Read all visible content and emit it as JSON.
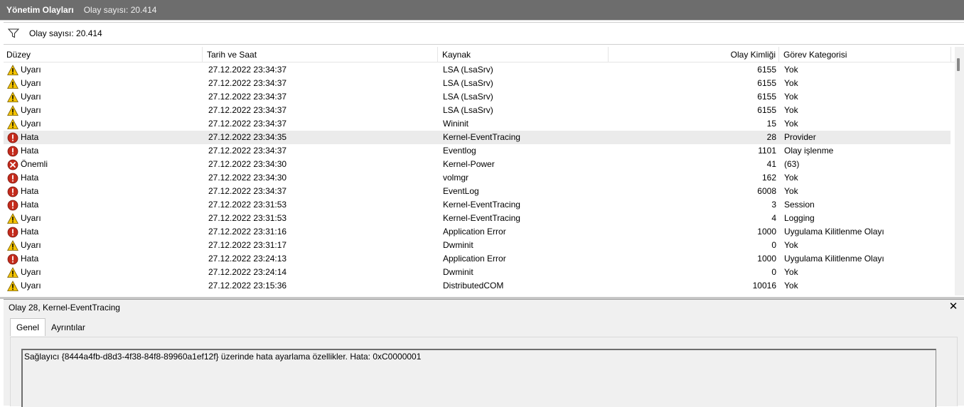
{
  "window": {
    "title": "Yönetim Olayları",
    "subtitle": "Olay sayısı: 20.414"
  },
  "filter": {
    "icon": "filter-icon",
    "count_label": "Olay sayısı: 20.414"
  },
  "grid": {
    "columns": [
      "Düzey",
      "Tarih ve Saat",
      "Kaynak",
      "Olay Kimliği",
      "Görev Kategorisi"
    ],
    "rows": [
      {
        "level": "Uyarı",
        "icon": "warning",
        "date": "27.12.2022 23:34:37",
        "source": "LSA (LsaSrv)",
        "id": "6155",
        "category": "Yok"
      },
      {
        "level": "Uyarı",
        "icon": "warning",
        "date": "27.12.2022 23:34:37",
        "source": "LSA (LsaSrv)",
        "id": "6155",
        "category": "Yok"
      },
      {
        "level": "Uyarı",
        "icon": "warning",
        "date": "27.12.2022 23:34:37",
        "source": "LSA (LsaSrv)",
        "id": "6155",
        "category": "Yok"
      },
      {
        "level": "Uyarı",
        "icon": "warning",
        "date": "27.12.2022 23:34:37",
        "source": "LSA (LsaSrv)",
        "id": "6155",
        "category": "Yok"
      },
      {
        "level": "Uyarı",
        "icon": "warning",
        "date": "27.12.2022 23:34:37",
        "source": "Wininit",
        "id": "15",
        "category": "Yok"
      },
      {
        "level": "Hata",
        "icon": "error",
        "date": "27.12.2022 23:34:35",
        "source": "Kernel-EventTracing",
        "id": "28",
        "category": "Provider",
        "selected": true
      },
      {
        "level": "Hata",
        "icon": "error",
        "date": "27.12.2022 23:34:37",
        "source": "Eventlog",
        "id": "1101",
        "category": "Olay işlenme"
      },
      {
        "level": "Önemli",
        "icon": "critical",
        "date": "27.12.2022 23:34:30",
        "source": "Kernel-Power",
        "id": "41",
        "category": "(63)"
      },
      {
        "level": "Hata",
        "icon": "error",
        "date": "27.12.2022 23:34:30",
        "source": "volmgr",
        "id": "162",
        "category": "Yok"
      },
      {
        "level": "Hata",
        "icon": "error",
        "date": "27.12.2022 23:34:37",
        "source": "EventLog",
        "id": "6008",
        "category": "Yok"
      },
      {
        "level": "Hata",
        "icon": "error",
        "date": "27.12.2022 23:31:53",
        "source": "Kernel-EventTracing",
        "id": "3",
        "category": "Session"
      },
      {
        "level": "Uyarı",
        "icon": "warning",
        "date": "27.12.2022 23:31:53",
        "source": "Kernel-EventTracing",
        "id": "4",
        "category": "Logging"
      },
      {
        "level": "Hata",
        "icon": "error",
        "date": "27.12.2022 23:31:16",
        "source": "Application Error",
        "id": "1000",
        "category": "Uygulama Kilitlenme Olayı"
      },
      {
        "level": "Uyarı",
        "icon": "warning",
        "date": "27.12.2022 23:31:17",
        "source": "Dwminit",
        "id": "0",
        "category": "Yok"
      },
      {
        "level": "Hata",
        "icon": "error",
        "date": "27.12.2022 23:24:13",
        "source": "Application Error",
        "id": "1000",
        "category": "Uygulama Kilitlenme Olayı"
      },
      {
        "level": "Uyarı",
        "icon": "warning",
        "date": "27.12.2022 23:24:14",
        "source": "Dwminit",
        "id": "0",
        "category": "Yok"
      },
      {
        "level": "Uyarı",
        "icon": "warning",
        "date": "27.12.2022 23:15:36",
        "source": "DistributedCOM",
        "id": "10016",
        "category": "Yok"
      }
    ]
  },
  "detail": {
    "title": "Olay 28, Kernel-EventTracing",
    "close_icon": "close-icon",
    "tabs": [
      "Genel",
      "Ayrıntılar"
    ],
    "active_tab": "Genel",
    "description": "Sağlayıcı {8444a4fb-d8d3-4f38-84f8-89960a1ef12f} üzerinde hata ayarlama özellikler. Hata: 0xC0000001"
  },
  "colors": {
    "titlebar_bg": "#6d6d6d",
    "selected_row": "#ebebeb",
    "warning_fill": "#f5c400",
    "error_fill": "#c42b1c",
    "panel_bg": "#f0f0f0"
  }
}
